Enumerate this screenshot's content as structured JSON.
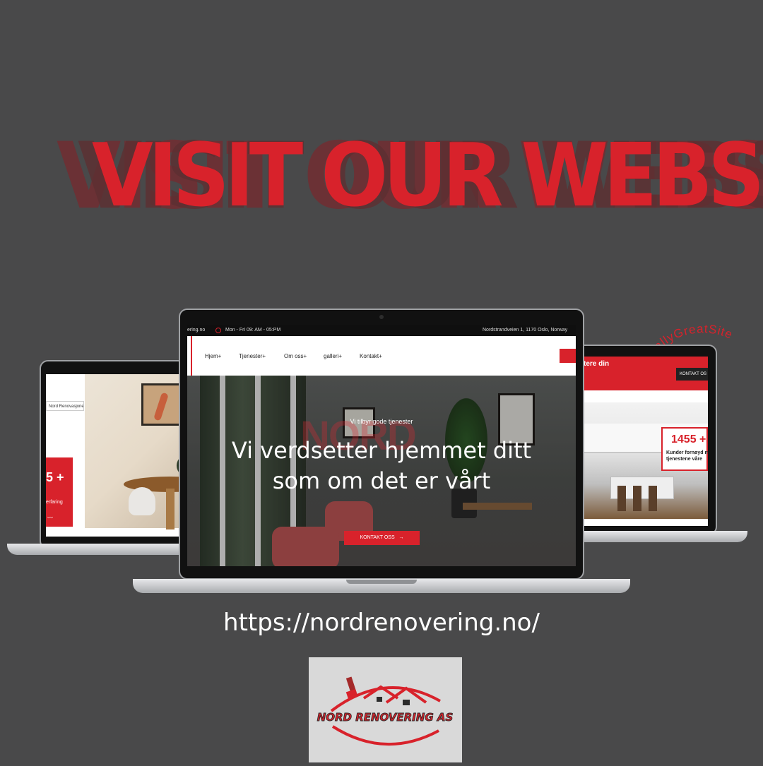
{
  "headline": "VISIT OUR WEBSITE",
  "watermark_curve": "ReallyGreatSite",
  "left_laptop": {
    "label": "Nord Renovasjoner",
    "badge_number": "5 +",
    "badge_text": "erfaring"
  },
  "center_laptop": {
    "topbar_left": "ering.no",
    "hours": "Mon - Fri 09: AM - 05:PM",
    "address": "Nordstrandveien 1, 1170 Oslo, Norway",
    "nav": [
      "Hjem+",
      "Tjenester+",
      "Om oss+",
      "galleri+",
      "Kontakt+"
    ],
    "kicker": "Vi tilbyr gode tjenester",
    "title_line_1": "Vi verdsetter hjemmet ditt",
    "title_line_2": "som om det er vårt",
    "ghost_text": "NORD",
    "button": "KONTAKT OSS"
  },
  "right_laptop": {
    "topbar_text": "tere din",
    "contact_button": "KONTAKT OS",
    "stat_number": "1455 +",
    "stat_text_1": "Kunder fornøyd m",
    "stat_text_2": "tjenestene våre"
  },
  "url": "https://nordrenovering.no/",
  "logo": {
    "text": "NORD RENOVERING AS"
  },
  "colors": {
    "background": "#49494a",
    "accent": "#d8222b",
    "text_light": "#ffffff",
    "logo_bg": "#d9d9d9"
  }
}
